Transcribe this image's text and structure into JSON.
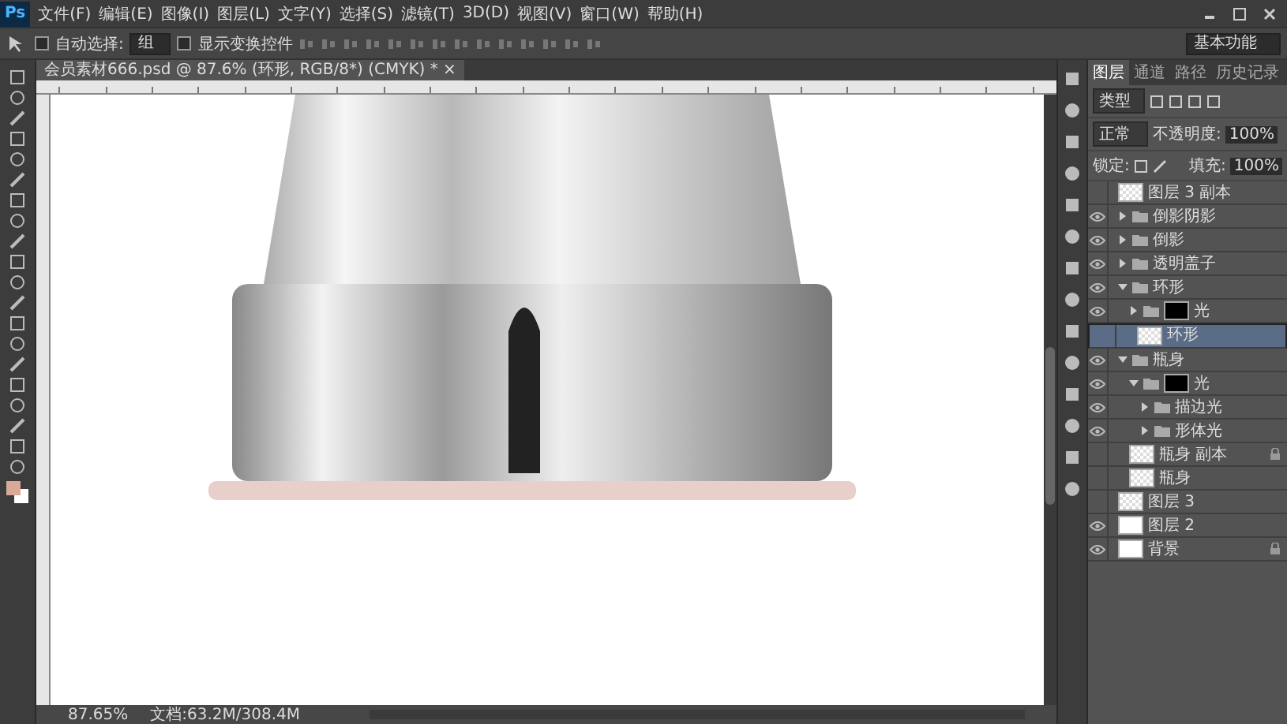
{
  "menu_bar": {
    "logo": "Ps",
    "items": [
      "文件(F)",
      "编辑(E)",
      "图像(I)",
      "图层(L)",
      "文字(Y)",
      "选择(S)",
      "滤镜(T)",
      "3D(D)",
      "视图(V)",
      "窗口(W)",
      "帮助(H)"
    ]
  },
  "options_bar": {
    "auto_select_checked": false,
    "auto_select_label": "自动选择:",
    "auto_select_value": "组",
    "show_transform_checked": false,
    "show_transform_label": "显示变换控件",
    "workspace": "基本功能"
  },
  "document_tab": {
    "title": "会员素材666.psd @ 87.6% (环形, RGB/8*) (CMYK) *",
    "close": "×"
  },
  "layers_panel": {
    "tabs": [
      {
        "label": "图层",
        "selected": true
      },
      {
        "label": "通道",
        "selected": false
      },
      {
        "label": "路径",
        "selected": false
      },
      {
        "label": "历史记录",
        "selected": false
      }
    ],
    "filter": "类型",
    "blend_mode": "正常",
    "opacity_label": "不透明度:",
    "opacity": "100%",
    "lock_label": "锁定:",
    "fill_label": "填充:",
    "fill": "100%",
    "layers": [
      {
        "name": "图层 3 副本",
        "kind": "layer",
        "transparent": true,
        "visible": false,
        "selected": false,
        "locked": false
      },
      {
        "name": "倒影阴影",
        "kind": "group",
        "has_mask": false,
        "visible": true,
        "expanded": false,
        "selected": false
      },
      {
        "name": "倒影",
        "kind": "group",
        "has_mask": false,
        "visible": true,
        "expanded": false,
        "selected": false
      },
      {
        "name": "透明盖子",
        "kind": "group",
        "has_mask": false,
        "visible": true,
        "expanded": false,
        "selected": false
      },
      {
        "name": "环形",
        "kind": "group",
        "has_mask": false,
        "visible": true,
        "expanded": true,
        "selected": false,
        "children": [
          {
            "name": "光",
            "kind": "group",
            "has_mask": true,
            "visible": true,
            "expanded": false,
            "selected": false
          },
          {
            "name": "环形",
            "kind": "layer",
            "transparent": true,
            "visible": false,
            "selected": true,
            "locked": false
          }
        ]
      },
      {
        "name": "瓶身",
        "kind": "group",
        "has_mask": false,
        "visible": true,
        "expanded": true,
        "selected": false,
        "children": [
          {
            "name": "光",
            "kind": "group",
            "has_mask": true,
            "visible": true,
            "expanded": true,
            "selected": false,
            "children": [
              {
                "name": "描边光",
                "kind": "group",
                "has_mask": false,
                "visible": true,
                "expanded": false,
                "selected": false
              },
              {
                "name": "形体光",
                "kind": "group",
                "has_mask": false,
                "visible": true,
                "expanded": false,
                "selected": false
              }
            ]
          },
          {
            "name": "瓶身 副本",
            "kind": "layer",
            "transparent": true,
            "visible": false,
            "selected": false,
            "locked": true
          },
          {
            "name": "瓶身",
            "kind": "layer",
            "transparent": true,
            "visible": false,
            "selected": false,
            "locked": false
          }
        ]
      },
      {
        "name": "图层 3",
        "kind": "layer",
        "transparent": true,
        "visible": false,
        "selected": false,
        "locked": false
      },
      {
        "name": "图层 2",
        "kind": "layer",
        "transparent": false,
        "visible": true,
        "selected": false,
        "locked": false
      },
      {
        "name": "背景",
        "kind": "layer",
        "transparent": false,
        "visible": true,
        "selected": false,
        "locked": true
      }
    ]
  },
  "status_bar": {
    "zoom": "87.65%",
    "doc_size": "文档:63.2M/308.4M"
  }
}
